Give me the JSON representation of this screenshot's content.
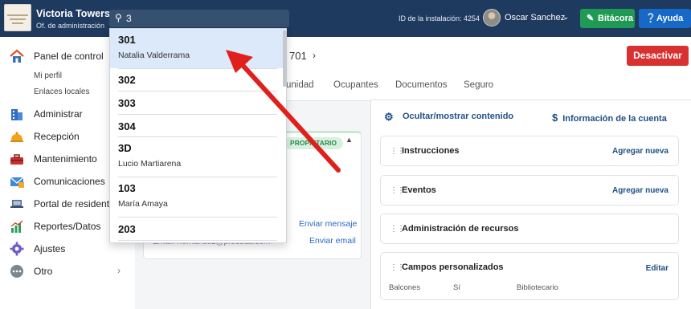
{
  "topbar": {
    "site_name": "Victoria Towers",
    "site_subtitle": "Of. de administración",
    "search_value": "3",
    "install_id": "ID de la instalación: 4254",
    "user_name": "Oscar Sanchez",
    "bitacora_label": "Bitácora",
    "ayuda_label": "Ayuda"
  },
  "sidebar": {
    "panel": "Panel de control",
    "sub1": "Mi perfil",
    "sub2": "Enlaces locales",
    "items": [
      "Administrar",
      "Recepción",
      "Mantenimiento",
      "Comunicaciones",
      "Portal de residente",
      "Reportes/Datos",
      "Ajustes",
      "Otro"
    ]
  },
  "header": {
    "unit_title": "701",
    "deactivate": "Desactivar",
    "tabs": [
      "unidad",
      "Ocupantes",
      "Documentos",
      "Seguro"
    ]
  },
  "resident_card": {
    "badge": "PROPIETARIO",
    "send_message": "Enviar mensaje",
    "send_email": "Enviar email",
    "email_partial": "Email: rfernandez@pruebas.com"
  },
  "right_panel": {
    "toggle_content": "Ocultar/mostrar contenido",
    "account_info": "Información de la cuenta",
    "cards": [
      {
        "title": "Instrucciones",
        "action": "Agregar nueva"
      },
      {
        "title": "Eventos",
        "action": "Agregar nueva"
      },
      {
        "title": "Administración de recursos",
        "action": ""
      },
      {
        "title": "Campos personalizados",
        "action": "Editar"
      }
    ],
    "custom_fields_row": [
      "Balcones",
      "Sí",
      "Bibliotecario"
    ]
  },
  "search_results": [
    {
      "unit": "301",
      "name": "Natalia Valderrama"
    },
    {
      "unit": "302",
      "name": ""
    },
    {
      "unit": "303",
      "name": ""
    },
    {
      "unit": "304",
      "name": ""
    },
    {
      "unit": "3D",
      "name": "Lucio Martiarena"
    },
    {
      "unit": "103",
      "name": "María Amaya"
    },
    {
      "unit": "203",
      "name": ""
    }
  ],
  "colors": {
    "topbar": "#1e3a5f",
    "bitacora": "#1f9a55",
    "ayuda": "#1769c8",
    "desactivar": "#d93131",
    "arrow": "#e0201c",
    "selected_row": "#dbe9fb"
  }
}
